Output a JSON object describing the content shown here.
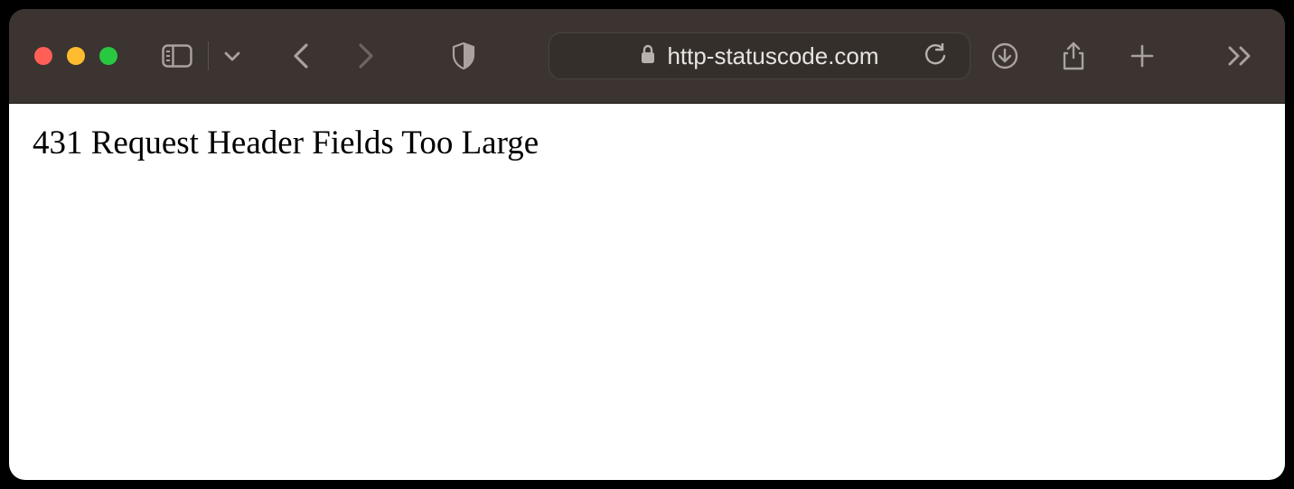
{
  "browser": {
    "url": "http-statuscode.com"
  },
  "page": {
    "body_text": "431 Request Header Fields Too Large"
  },
  "icons": {
    "sidebar": "sidebar-icon",
    "tabs_dropdown": "chevron-down-icon",
    "back": "chevron-left-icon",
    "forward": "chevron-right-icon",
    "shield": "shield-icon",
    "lock": "lock-icon",
    "reload": "reload-icon",
    "downloads": "download-icon",
    "share": "share-icon",
    "new_tab": "plus-icon",
    "overflow": "chevron-double-right-icon"
  }
}
